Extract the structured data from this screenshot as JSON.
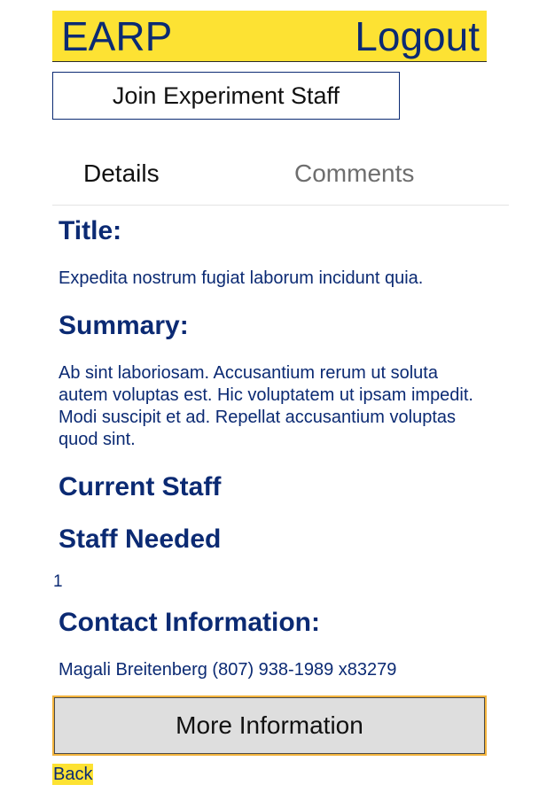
{
  "header": {
    "brand": "EARP",
    "logout_label": "Logout"
  },
  "actions": {
    "join_label": "Join Experiment Staff",
    "more_info_label": "More Information",
    "back_label": "Back"
  },
  "tabs": [
    {
      "label": "Details",
      "active": true
    },
    {
      "label": "Comments",
      "active": false
    }
  ],
  "details": {
    "title_heading": "Title:",
    "title_value": "Expedita nostrum fugiat laborum incidunt quia.",
    "summary_heading": "Summary:",
    "summary_value": "Ab sint laboriosam. Accusantium rerum ut soluta autem voluptas est. Hic voluptatem ut ipsam impedit. Modi suscipit et ad. Repellat accusantium voluptas quod sint.",
    "current_staff_heading": "Current Staff",
    "staff_needed_heading": "Staff Needed",
    "staff_needed_value": "1",
    "contact_heading": "Contact Information:",
    "contact_value": "Magali Breitenberg (807) 938-1989 x83279"
  },
  "colors": {
    "header_bg": "#fde233",
    "text_primary": "#0b2a73",
    "button_bg": "#dedede",
    "button_focus_border": "#f2b33c"
  }
}
